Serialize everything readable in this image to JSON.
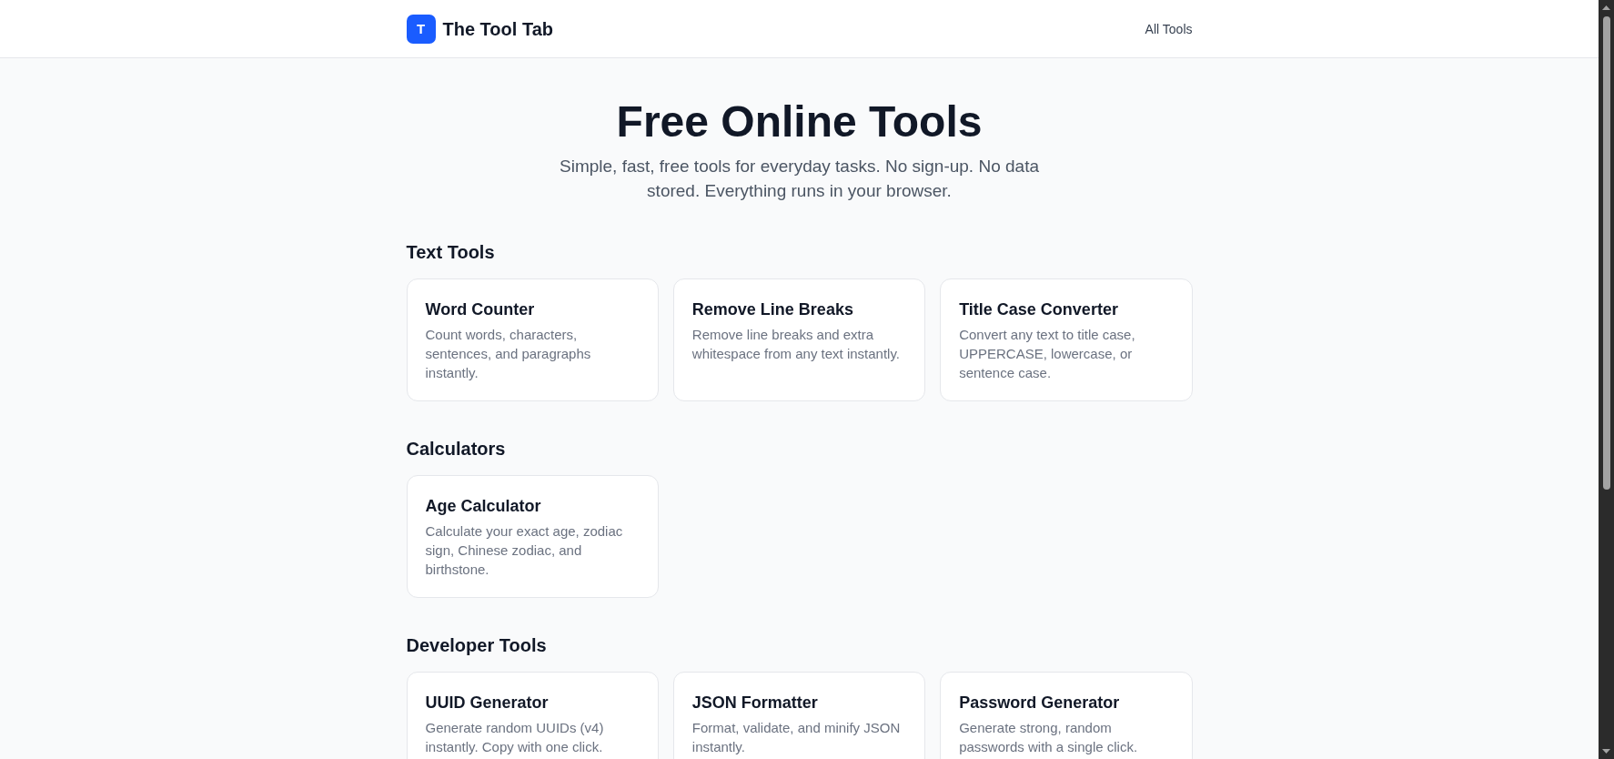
{
  "header": {
    "logo_letter": "T",
    "site_name": "The Tool Tab",
    "nav_links": [
      "All Tools"
    ]
  },
  "hero": {
    "title": "Free Online Tools",
    "subtitle": "Simple, fast, free tools for everyday tasks. No sign-up. No data stored. Everything runs in your browser."
  },
  "sections": [
    {
      "heading": "Text Tools",
      "tools": [
        {
          "name": "Word Counter",
          "description": "Count words, characters, sentences, and paragraphs instantly."
        },
        {
          "name": "Remove Line Breaks",
          "description": "Remove line breaks and extra whitespace from any text instantly."
        },
        {
          "name": "Title Case Converter",
          "description": "Convert any text to title case, UPPERCASE, lowercase, or sentence case."
        }
      ]
    },
    {
      "heading": "Calculators",
      "tools": [
        {
          "name": "Age Calculator",
          "description": "Calculate your exact age, zodiac sign, Chinese zodiac, and birthstone."
        }
      ]
    },
    {
      "heading": "Developer Tools",
      "tools": [
        {
          "name": "UUID Generator",
          "description": "Generate random UUIDs (v4) instantly. Copy with one click."
        },
        {
          "name": "JSON Formatter",
          "description": "Format, validate, and minify JSON instantly."
        },
        {
          "name": "Password Generator",
          "description": "Generate strong, random passwords with a single click."
        }
      ]
    }
  ]
}
